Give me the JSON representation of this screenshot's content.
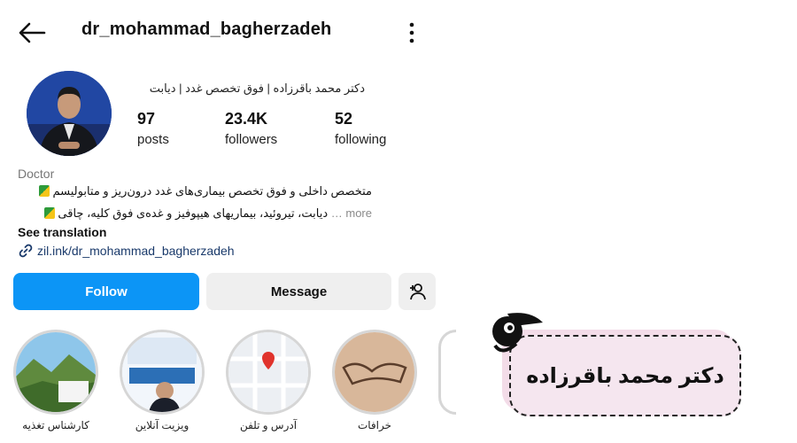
{
  "header": {
    "username": "dr_mohammad_bagherzadeh"
  },
  "profile": {
    "full_name": "دکتر محمد باقرزاده | فوق تخصص غدد | دیابت",
    "stats": [
      {
        "value": "97",
        "label": "posts"
      },
      {
        "value": "23.4K",
        "label": "followers"
      },
      {
        "value": "52",
        "label": "following"
      }
    ],
    "category": "Doctor",
    "bio_line1": "متخصص داخلی و فوق تخصص بیماری‌های غدد درون‌ریز و متابولیسم",
    "bio_line2": "دیابت، تیروئید، بیماریهای هیپوفیز و غده‌ی فوق کلیه، چاقی",
    "more_label": "more …",
    "see_translation": "See translation",
    "link": "zil.ink/dr_mohammad_bagherzadeh"
  },
  "actions": {
    "follow": "Follow",
    "message": "Message"
  },
  "highlights": [
    {
      "label": "کارشناس تغذیه"
    },
    {
      "label": "ویزیت آنلاین"
    },
    {
      "label": "آدرس و تلفن"
    },
    {
      "label": "خرافات"
    }
  ],
  "badge": {
    "text": "دکتر محمد باقرزاده"
  },
  "colors": {
    "follow_blue": "#0c95f6",
    "button_gray": "#efefef",
    "card_pink": "#f5e6ef"
  }
}
